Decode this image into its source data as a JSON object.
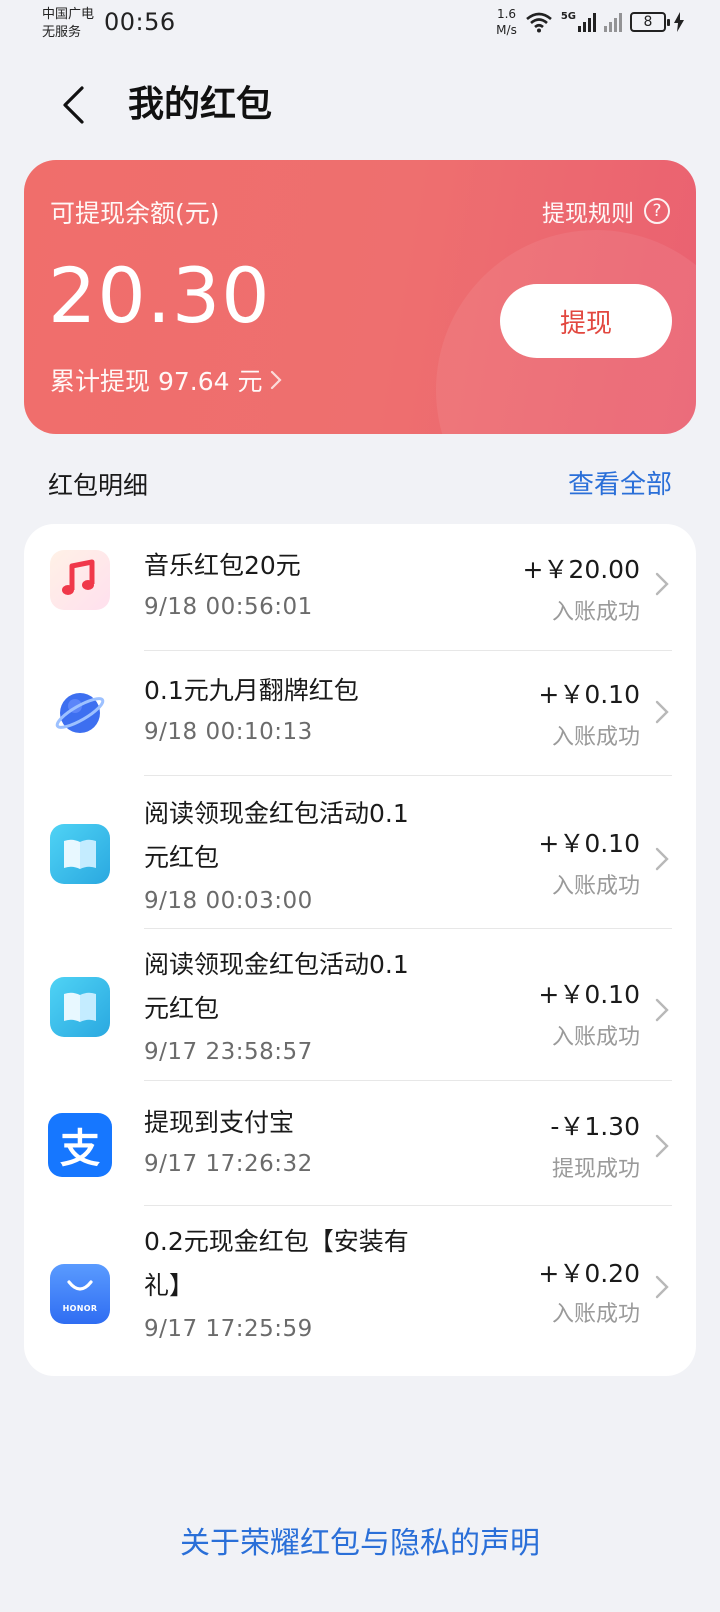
{
  "status_bar": {
    "carrier_line1": "中国广电",
    "carrier_line2": "无服务",
    "time": "00:56",
    "speed_value": "1.6",
    "speed_unit": "M/s",
    "network": "5G",
    "battery": "8"
  },
  "header": {
    "title": "我的红包"
  },
  "balance_card": {
    "label": "可提现余额(元)",
    "rules_label": "提现规则",
    "amount": "20.30",
    "total_label": "累计提现 97.64 元",
    "withdraw_label": "提现",
    "accent_color": "#f06e6b"
  },
  "details": {
    "title": "红包明细",
    "view_all": "查看全部",
    "items": [
      {
        "title": "音乐红包20元",
        "time": "9/18 00:56:01",
        "amount": "+￥20.00",
        "status": "入账成功",
        "icon": "music-app-icon"
      },
      {
        "title": "0.1元九月翻牌红包",
        "time": "9/18 00:10:13",
        "amount": "+￥0.10",
        "status": "入账成功",
        "icon": "browser-planet-icon"
      },
      {
        "title": "阅读领现金红包活动0.1元红包",
        "time": "9/18 00:03:00",
        "amount": "+￥0.10",
        "status": "入账成功",
        "icon": "reader-book-icon"
      },
      {
        "title": "阅读领现金红包活动0.1元红包",
        "time": "9/17 23:58:57",
        "amount": "+￥0.10",
        "status": "入账成功",
        "icon": "reader-book-icon"
      },
      {
        "title": "提现到支付宝",
        "time": "9/17 17:26:32",
        "amount": "-￥1.30",
        "status": "提现成功",
        "icon": "alipay-icon"
      },
      {
        "title": "0.2元现金红包【安装有礼】",
        "time": "9/17 17:25:59",
        "amount": "+￥0.20",
        "status": "入账成功",
        "icon": "honor-store-icon"
      }
    ]
  },
  "footer": {
    "link": "关于荣耀红包与隐私的声明"
  },
  "icon_labels": {
    "alipay": "支",
    "honor": "HONOR"
  }
}
